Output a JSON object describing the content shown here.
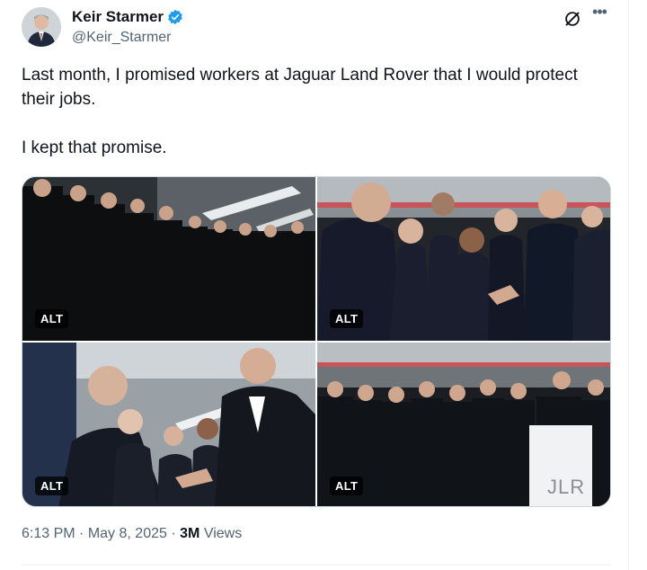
{
  "author": {
    "name": "Keir Starmer",
    "handle": "@Keir_Starmer",
    "verified_icon": "verified-badge-icon"
  },
  "tweet": {
    "text_line1": "Last month, I promised workers at Jaguar Land Rover that I would protect their jobs.",
    "text_line2": "I kept that promise."
  },
  "media": {
    "photos": [
      {
        "alt_label": "ALT"
      },
      {
        "alt_label": "ALT"
      },
      {
        "alt_label": "ALT"
      },
      {
        "alt_label": "ALT"
      }
    ],
    "sign_text": "JLR"
  },
  "meta": {
    "time": "6:13 PM",
    "date": "May 8, 2025",
    "views_count": "3M",
    "views_label": "Views"
  },
  "colors": {
    "accent": "#1d9bf0",
    "muted": "#536471",
    "text": "#0f1419"
  }
}
